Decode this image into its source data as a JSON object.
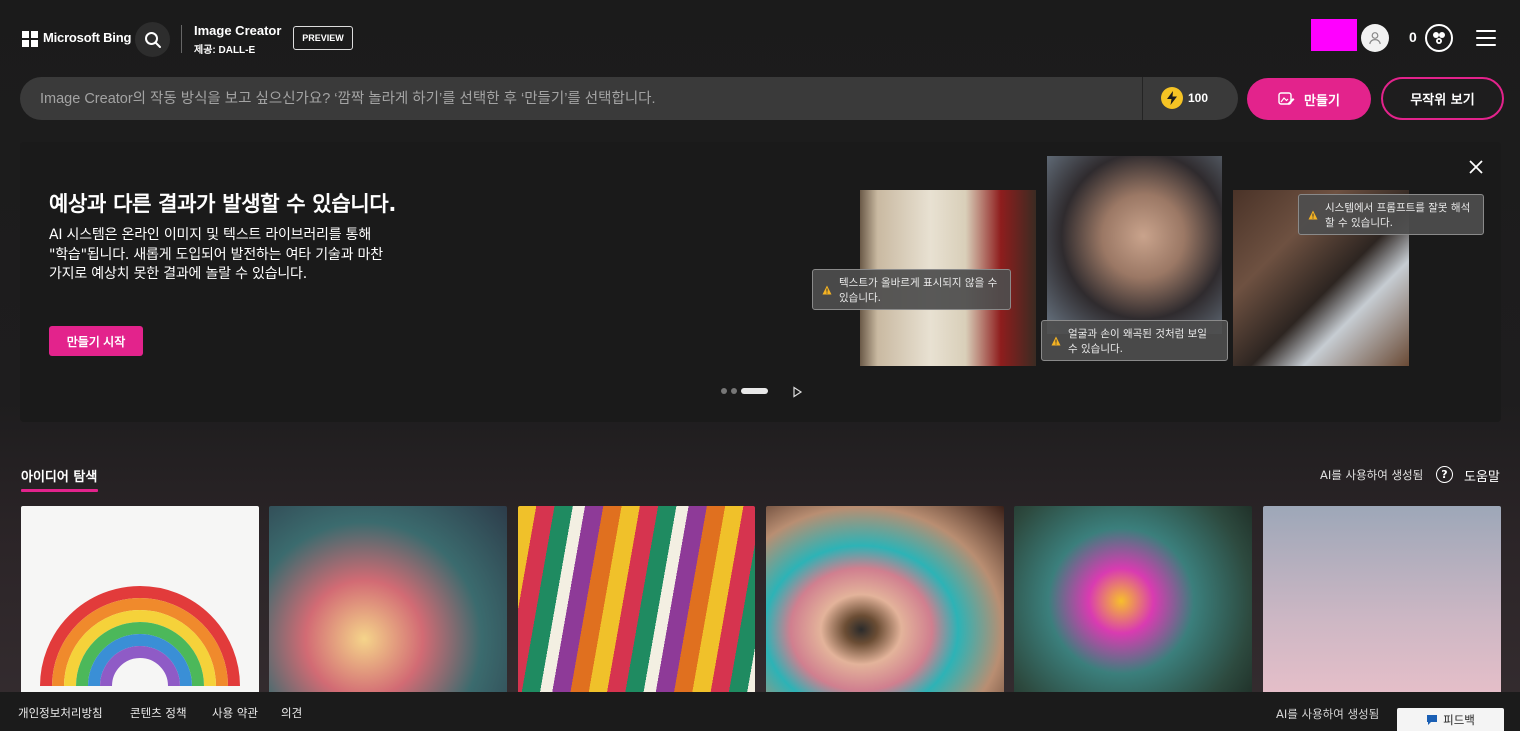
{
  "header": {
    "brand": "Microsoft Bing",
    "app_title": "Image Creator",
    "app_subtitle": "제공: DALL-E",
    "preview_badge": "PREVIEW",
    "rewards_count": "0"
  },
  "prompt": {
    "placeholder": "Image Creator의 작동 방식을 보고 싶으신가요? ‘깜짝 놀라게 하기’를 선택한 후 ‘만들기’를 선택합니다.",
    "boost_count": "100",
    "create_label": "만들기",
    "random_label": "무작위 보기"
  },
  "banner": {
    "title": "예상과 다른 결과가 발생할 수 있습니다.",
    "description": "AI 시스템은 온라인 이미지 및 텍스트 라이브러리를 통해 \"학습\"됩니다. 새롭게 도입되어 발전하는 여타 기술과 마찬가지로 예상치 못한 결과에 놀랄 수 있습니다.",
    "start_label": "만들기 시작",
    "warnings": [
      "텍스트가 올바르게 표시되지 않을 수 있습니다.",
      "얼굴과 손이 왜곡된 것처럼 보일 수 있습니다.",
      "시스템에서 프롬프트를 잘못 해석할 수 있습니다."
    ],
    "carousel": {
      "total": 3,
      "active": 3
    }
  },
  "explore": {
    "tab_label": "아이디어 탐색",
    "ai_generated": "AI를 사용하여 생성됨",
    "help_label": "도움말"
  },
  "footer": {
    "links": [
      "개인정보처리방침",
      "콘텐츠 정책",
      "사용 약관",
      "의견"
    ],
    "ai_generated": "AI를 사용하여 생성됨",
    "feedback_label": "피드백"
  },
  "colors": {
    "accent": "#e3238c",
    "boost": "#f5c324"
  }
}
